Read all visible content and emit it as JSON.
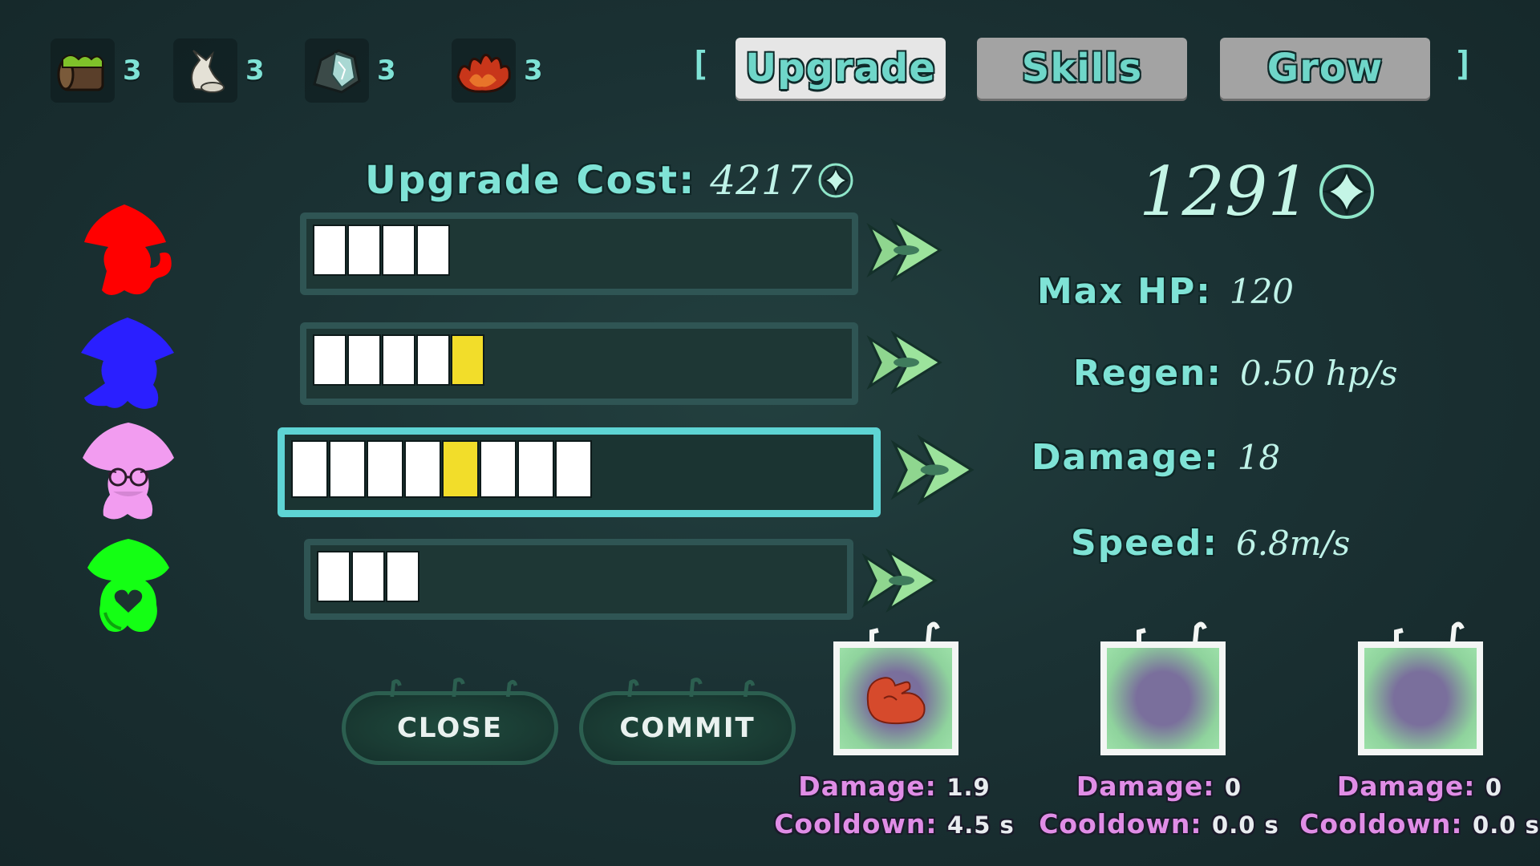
{
  "resources": [
    {
      "icon": "mossy-log-icon",
      "count": "3"
    },
    {
      "icon": "bone-creature-icon",
      "count": "3"
    },
    {
      "icon": "crystal-rock-icon",
      "count": "3"
    },
    {
      "icon": "fire-icon",
      "count": "3"
    }
  ],
  "tabs": {
    "bracket_left": "[",
    "bracket_right": "]",
    "upgrade": "Upgrade",
    "skills": "Skills",
    "grow": "Grow",
    "active": "Upgrade"
  },
  "upgrade_cost": {
    "label": "Upgrade Cost:",
    "value": "4217"
  },
  "currency": {
    "value": "1291"
  },
  "creatures": [
    {
      "name": "red",
      "color": "#ff0000",
      "level": 4,
      "highlight_index": null
    },
    {
      "name": "blue",
      "color": "#2a1fff",
      "level": 5,
      "highlight_index": 4
    },
    {
      "name": "pink",
      "color": "#f29cf0",
      "level": 8,
      "highlight_index": 4,
      "selected": true
    },
    {
      "name": "green",
      "color": "#14ff14",
      "level": 3,
      "highlight_index": null
    }
  ],
  "stats": {
    "max_hp": {
      "label": "Max HP:",
      "value": "120"
    },
    "regen": {
      "label": "Regen:",
      "value": "0.50 hp/s"
    },
    "damage": {
      "label": "Damage:",
      "value": "18"
    },
    "speed": {
      "label": "Speed:",
      "value": "6.8m/s"
    }
  },
  "buttons": {
    "close": "CLOSE",
    "commit": "COMMIT"
  },
  "skills": [
    {
      "icon": "flex-arm-icon",
      "damage_label": "Damage:",
      "damage": "1.9",
      "cooldown_label": "Cooldown:",
      "cooldown": "4.5 s"
    },
    {
      "icon": "empty-slot-icon",
      "damage_label": "Damage:",
      "damage": "0",
      "cooldown_label": "Cooldown:",
      "cooldown": "0.0 s"
    },
    {
      "icon": "empty-slot-icon",
      "damage_label": "Damage:",
      "damage": "0",
      "cooldown_label": "Cooldown:",
      "cooldown": "0.0 s"
    }
  ],
  "colors": {
    "accent": "#7fe3d6",
    "selected_border": "#5ed4d4",
    "gold_segment": "#f2dd2a",
    "skill_label": "#e08de6"
  }
}
